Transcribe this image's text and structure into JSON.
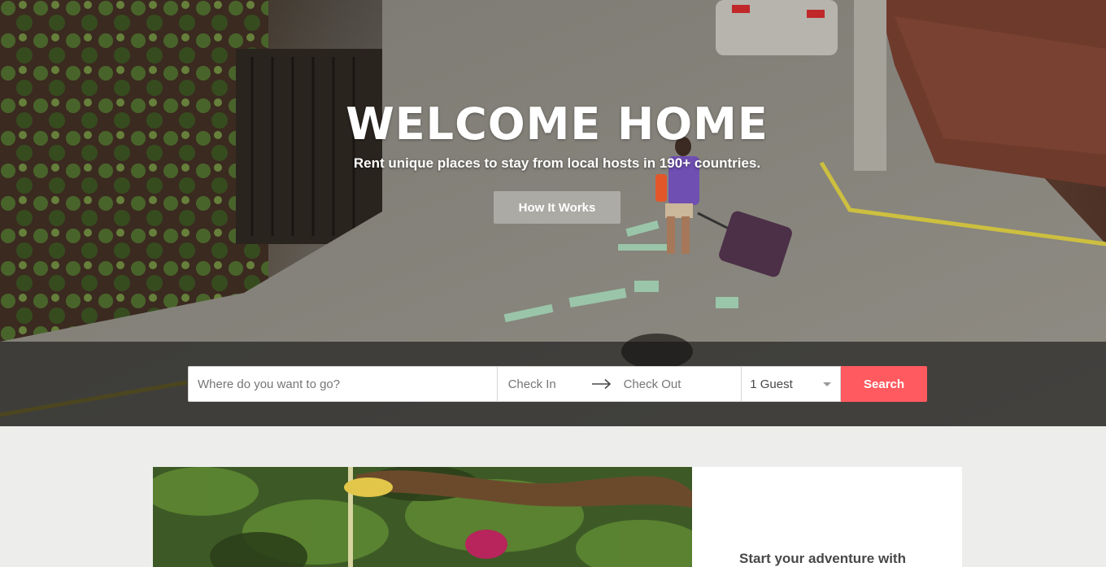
{
  "hero": {
    "headline": "WELCOME HOME",
    "subheadline": "Rent unique places to stay from local hosts in 190+ countries.",
    "how_it_works_label": "How It Works"
  },
  "search": {
    "where_placeholder": "Where do you want to go?",
    "check_in_label": "Check In",
    "check_out_label": "Check Out",
    "guests_value": "1 Guest",
    "search_label": "Search"
  },
  "promo": {
    "title": "Start your adventure with"
  },
  "colors": {
    "accent": "#ff5a5f",
    "page_background": "#edeeeb",
    "text_dark": "#484848",
    "placeholder": "#767676"
  },
  "icons": {
    "date_separator": "arrow-right-icon",
    "guest_dropdown": "caret-down-icon"
  }
}
